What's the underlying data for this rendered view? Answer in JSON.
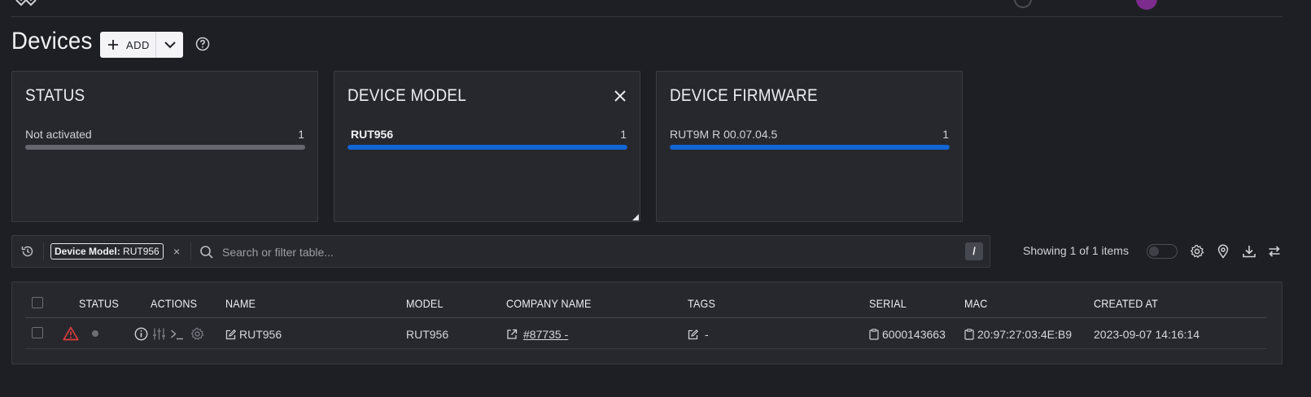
{
  "page": {
    "title": "Devices"
  },
  "toolbar": {
    "add_label": "ADD"
  },
  "cards": [
    {
      "title": "STATUS",
      "row_label": "Not activated",
      "row_count": "1",
      "fraction": 1.0
    },
    {
      "title": "DEVICE MODEL",
      "row_label": "RUT956",
      "row_count": "1",
      "fraction": 1.0
    },
    {
      "title": "DEVICE FIRMWARE",
      "row_label": "RUT9M R 00.07.04.5",
      "row_count": "1",
      "fraction": 1.0
    }
  ],
  "filter": {
    "chip_key": "Device Model:",
    "chip_value": "RUT956",
    "chip_remove": "×",
    "search_placeholder": "Search or filter table...",
    "shortcut_key": "/"
  },
  "table_controls": {
    "showing_text": "Showing 1 of 1 items"
  },
  "table": {
    "headers": {
      "status": "STATUS",
      "actions": "ACTIONS",
      "name": "NAME",
      "model": "MODEL",
      "company": "COMPANY NAME",
      "tags": "TAGS",
      "serial": "SERIAL",
      "mac": "MAC",
      "created": "CREATED AT"
    },
    "rows": [
      {
        "name": "RUT956",
        "model": "RUT956",
        "company": "#87735 -",
        "tags": "-",
        "serial": "6000143663",
        "mac": "20:97:27:03:4E:B9",
        "created": "2023-09-07 14:16:14"
      }
    ]
  },
  "colors": {
    "accent_blue": "#1266d6",
    "warning_red": "#e03b3b",
    "background": "#1e1f24",
    "panel": "#27282e"
  },
  "icons": {
    "help": "question-circle-icon",
    "history": "history-icon",
    "search": "search-icon",
    "settings": "gear-icon",
    "location": "map-pin-icon",
    "download": "download-icon",
    "refresh": "refresh-icon",
    "warning": "warning-triangle-icon",
    "info": "info-icon",
    "sliders": "sliders-icon",
    "terminal": "terminal-icon",
    "edit": "edit-icon",
    "external": "external-link-icon",
    "copy": "copy-icon",
    "close": "close-icon"
  }
}
